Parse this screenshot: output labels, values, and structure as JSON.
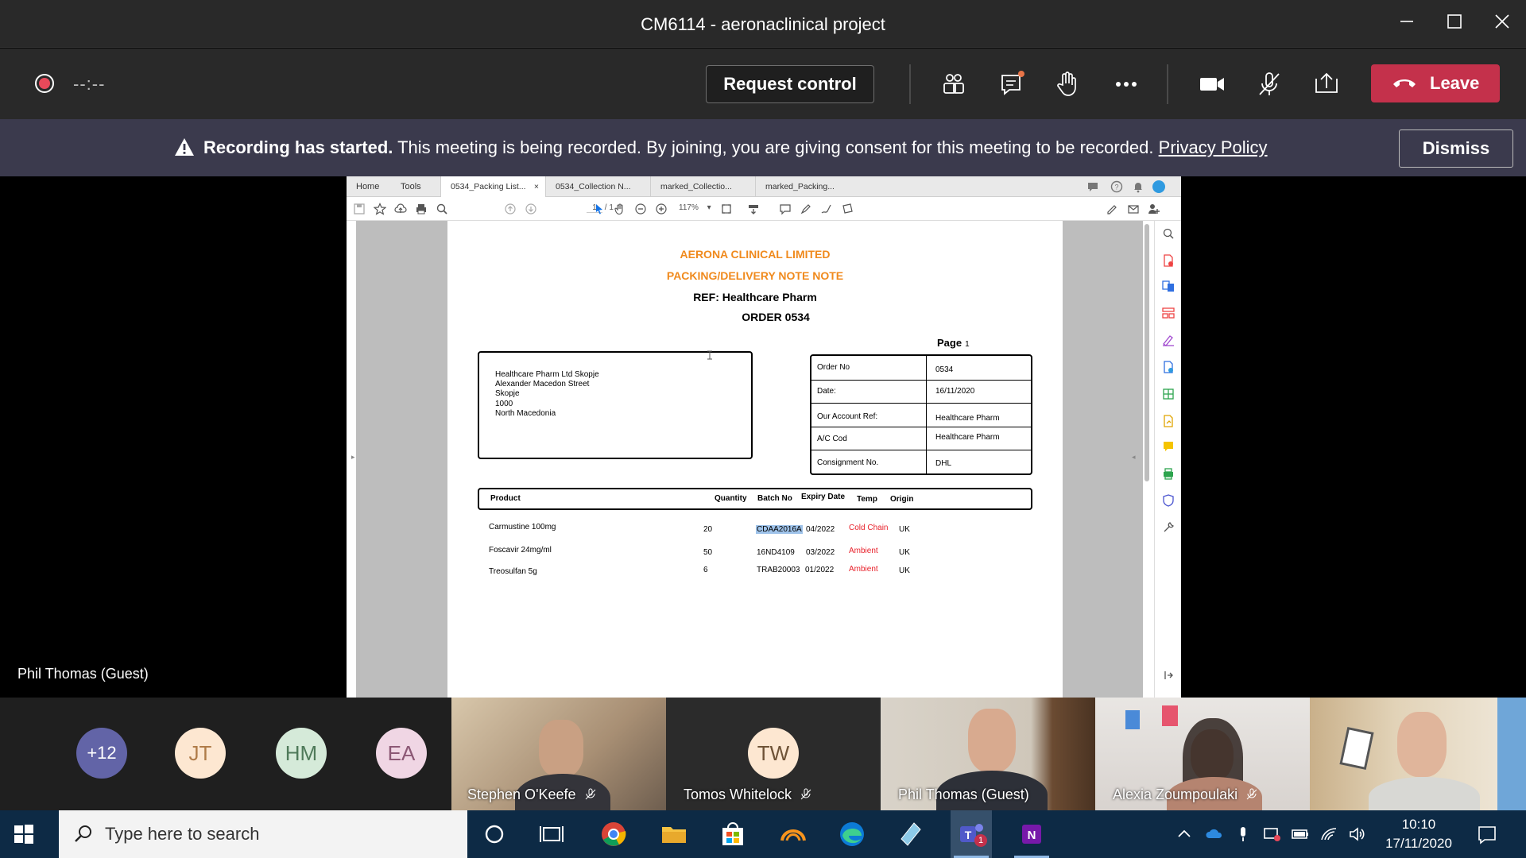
{
  "window": {
    "title": "CM6114 - aeronaclinical project"
  },
  "meeting": {
    "timer": "--:--",
    "request_control_label": "Request control",
    "leave_label": "Leave"
  },
  "banner": {
    "bold": "Recording has started.",
    "message": " This meeting is being recorded. By joining, you are giving consent for this meeting to be recorded. ",
    "link": "Privacy Policy",
    "dismiss_label": "Dismiss"
  },
  "presenter_label": "Phil Thomas (Guest)",
  "acrobat": {
    "nav": {
      "home": "Home",
      "tools": "Tools"
    },
    "tabs": [
      "0534_Packing List...",
      "0534_Collection N...",
      "marked_Collectio...",
      "marked_Packing..."
    ],
    "page_current": "1",
    "page_total": "/ 1",
    "zoom": "117%"
  },
  "document": {
    "company": "AERONA CLINICAL LIMITED",
    "doc_title": "PACKING/DELIVERY NOTE NOTE",
    "ref": "REF: Healthcare Pharm",
    "order": "ORDER 0534",
    "page_label": "Page",
    "page_number": "1",
    "address": [
      "Healthcare Pharm Ltd Skopje",
      "Alexander Macedon Street",
      "Skopje",
      "1000",
      "North Macedonia"
    ],
    "info": [
      {
        "key": "Order No",
        "value": "0534"
      },
      {
        "key": "Date:",
        "value": "16/11/2020"
      },
      {
        "key": "Our Account Ref:",
        "value": "Healthcare Pharm"
      },
      {
        "key": "A/C Cod",
        "value": "Healthcare Pharm"
      },
      {
        "key": "Consignment No.",
        "value": "DHL"
      }
    ],
    "columns": [
      "Product",
      "Quantity",
      "Batch No",
      "Expiry Date",
      "Temp",
      "Origin"
    ],
    "rows": [
      {
        "product": "Carmustine 100mg",
        "quantity": "20",
        "batch": "CDAA2016A",
        "expiry": "04/2022",
        "temp": "Cold Chain",
        "origin": "UK"
      },
      {
        "product": "Foscavir 24mg/ml",
        "quantity": "50",
        "batch": "16ND4109",
        "expiry": "03/2022",
        "temp": "Ambient",
        "origin": "UK"
      },
      {
        "product": "Treosulfan 5g",
        "quantity": "6",
        "batch": "TRAB20003",
        "expiry": "01/2022",
        "temp": "Ambient",
        "origin": "UK"
      }
    ]
  },
  "participants": {
    "overflow": "+12",
    "avatars": [
      {
        "initials": "JT",
        "color": "#fde7d1",
        "text": "#b07c49"
      },
      {
        "initials": "HM",
        "color": "#d5ead9",
        "text": "#4f7a5a"
      },
      {
        "initials": "EA",
        "color": "#f0d6e4",
        "text": "#8c5875"
      }
    ],
    "video": [
      {
        "name": "Stephen O'Keefe",
        "muted": true
      },
      {
        "name": "Tomos Whitelock",
        "muted": true,
        "initials": "TW"
      },
      {
        "name": "Phil Thomas (Guest)",
        "muted": false
      },
      {
        "name": "Alexia Zoumpoulaki",
        "muted": true
      },
      {
        "name": "",
        "muted": false
      }
    ]
  },
  "taskbar": {
    "search_placeholder": "Type here to search",
    "time": "10:10",
    "date": "17/11/2020",
    "teams_badge": "1"
  },
  "colors": {
    "leave": "#c4314b",
    "banner": "#3b3a4d",
    "brand_orange": "#f08a1d",
    "ambient_red": "#e8202a",
    "taskbar": "#0d2a45"
  }
}
